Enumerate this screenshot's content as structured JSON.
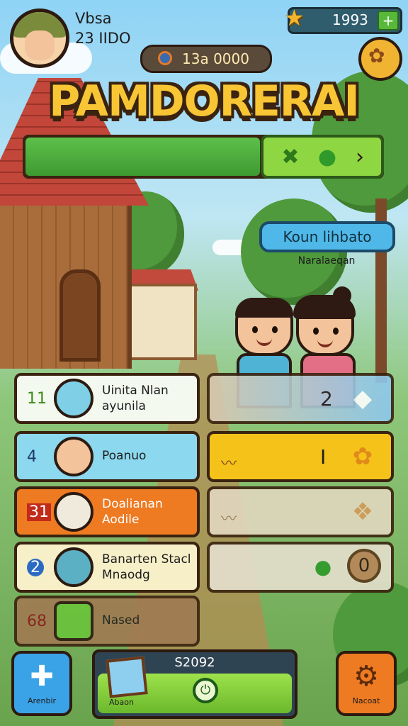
{
  "player": {
    "name": "Vbsa",
    "score": "23 IIDO"
  },
  "currency": {
    "coins": "1993",
    "plus": "+",
    "gems": "13a 0000"
  },
  "title": "PAMDORERAI",
  "progress": {
    "fraction": 0.66
  },
  "quest": {
    "button_label": "Koun lihbato",
    "subtitle": "Naralaeqan"
  },
  "left_items": [
    {
      "number": "11",
      "label_line1": "Uinita Nlan",
      "label_line2": "ayunila"
    },
    {
      "number": "4",
      "label_line1": "Poanuo",
      "label_line2": ""
    },
    {
      "number": "31",
      "label_line1": "Doalianan",
      "label_line2": "Aodile"
    },
    {
      "number": "2",
      "label_line1": "Banarten Stacl",
      "label_line2": "Mnaodg"
    },
    {
      "number": "68",
      "label_line1": "Nased",
      "label_line2": ""
    }
  ],
  "right_items": [
    {
      "value": "2"
    },
    {
      "value": "I"
    },
    {
      "value": ""
    },
    {
      "value": "0"
    }
  ],
  "bottom": {
    "left_label": "Arenbir",
    "center_value": "S2092",
    "center_label": "Abaon",
    "right_label": "Nacoat"
  },
  "icons": {
    "coin": "star-icon",
    "gem": "gem-icon",
    "map": "map-icon",
    "puzzle": "puzzle-icon",
    "gear": "gear-icon",
    "power": "power-icon"
  },
  "colors": {
    "title": "#f8c534",
    "accent_green": "#8ed642",
    "accent_blue": "#4fb8e8",
    "accent_orange": "#ee7a22"
  }
}
